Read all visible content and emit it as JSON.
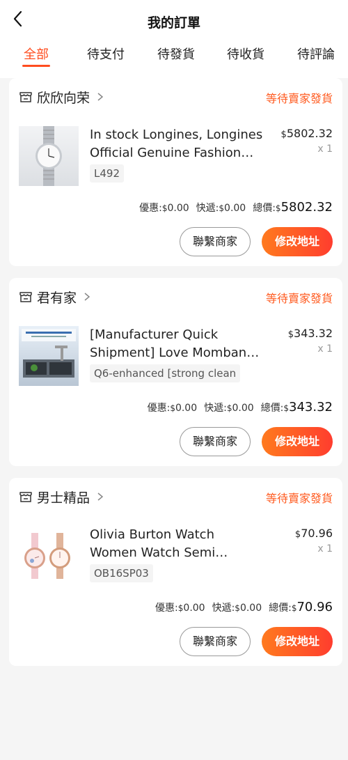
{
  "header": {
    "title": "我的訂單",
    "back_icon": "chevron-left-icon"
  },
  "tabs": [
    {
      "label": "全部",
      "active": true
    },
    {
      "label": "待支付"
    },
    {
      "label": "待發貨"
    },
    {
      "label": "待收貨"
    },
    {
      "label": "待評論"
    }
  ],
  "labels": {
    "discount": "優惠:",
    "shipping": "快遞:",
    "total": "總價:",
    "currency": "$",
    "contact_button": "聯繫商家",
    "modify_address_button": "修改地址"
  },
  "colors": {
    "accent": "#ff4d1f",
    "button_start": "#ff7a1e",
    "button_end": "#ff3d2e"
  },
  "orders": [
    {
      "shop": "欣欣向荣",
      "status": "等待賣家發貨",
      "product_title": "In stock Longines, Longines Official Genuine Fashion Watch",
      "sku": "L492",
      "price": "5802.32",
      "qty": "x 1",
      "discount": "0.00",
      "shipping": "0.00",
      "total": "5802.32"
    },
    {
      "shop": "君有家",
      "status": "等待賣家發貨",
      "product_title": "[Manufacturer Quick Shipment] Love Mombang Kitchen Sink",
      "sku": "Q6-enhanced [strong clean",
      "price": "343.32",
      "qty": "x 1",
      "discount": "0.00",
      "shipping": "0.00",
      "total": "343.32"
    },
    {
      "shop": "男士精品",
      "status": "等待賣家發貨",
      "product_title": "Olivia Burton Watch Women Watch Semi Precious Rose Gold",
      "sku": "OB16SP03",
      "price": "70.96",
      "qty": "x 1",
      "discount": "0.00",
      "shipping": "0.00",
      "total": "70.96"
    }
  ]
}
